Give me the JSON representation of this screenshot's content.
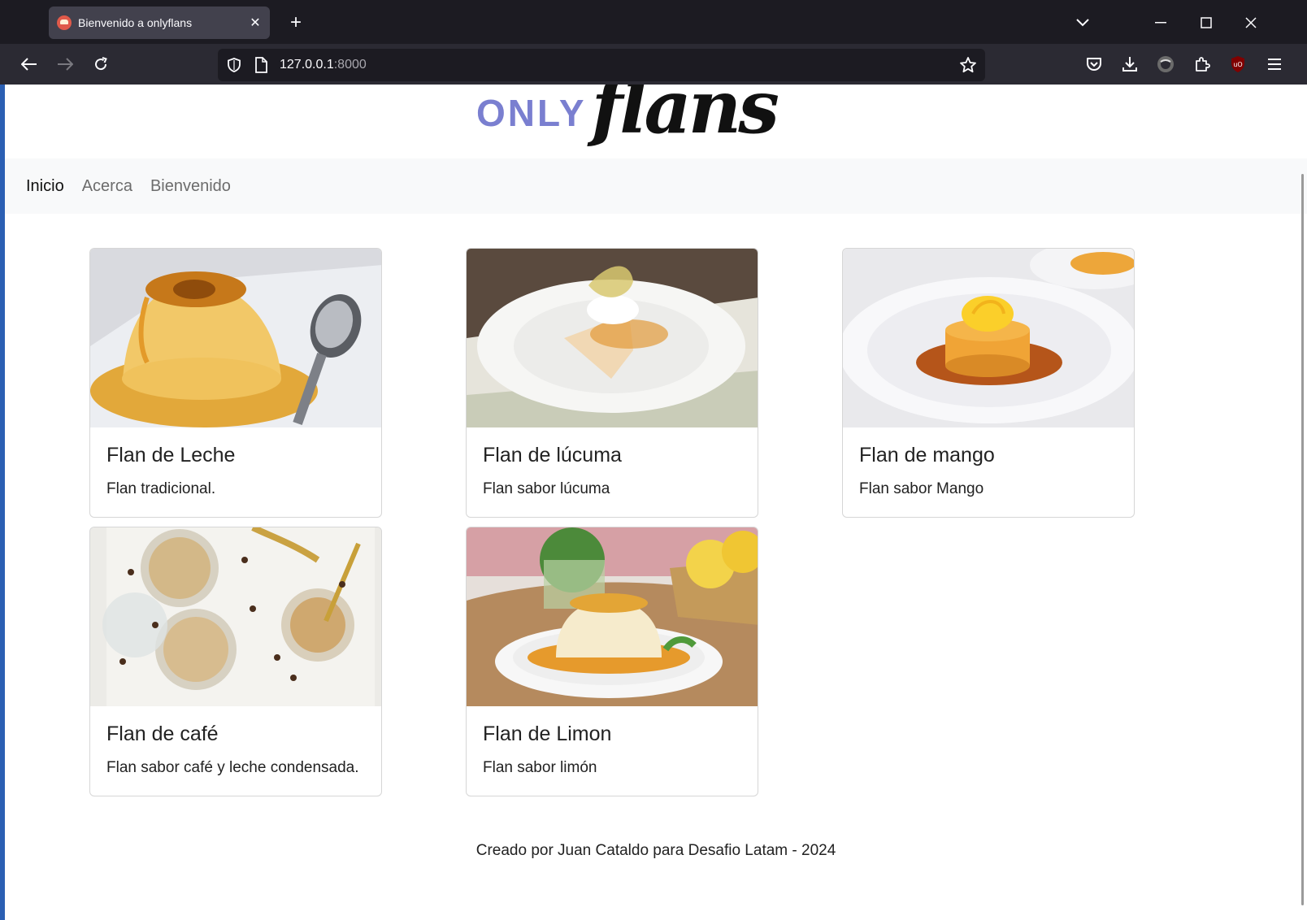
{
  "browser": {
    "tab_title": "Bienvenido a onlyflans",
    "url_host": "127.0.0.1",
    "url_port": ":8000"
  },
  "site": {
    "logo_only": "ONLY",
    "logo_script": "flans",
    "nav": [
      "Inicio",
      "Acerca",
      "Bienvenido"
    ],
    "cards": [
      {
        "title": "Flan de Leche",
        "description": "Flan tradicional."
      },
      {
        "title": "Flan de lúcuma",
        "description": "Flan sabor lúcuma"
      },
      {
        "title": "Flan de mango",
        "description": "Flan sabor Mango"
      },
      {
        "title": "Flan de café",
        "description": "Flan sabor café y leche condensada."
      },
      {
        "title": "Flan de Limon",
        "description": "Flan sabor limón"
      }
    ],
    "footer": "Creado por Juan Cataldo para Desafio Latam - 2024"
  }
}
